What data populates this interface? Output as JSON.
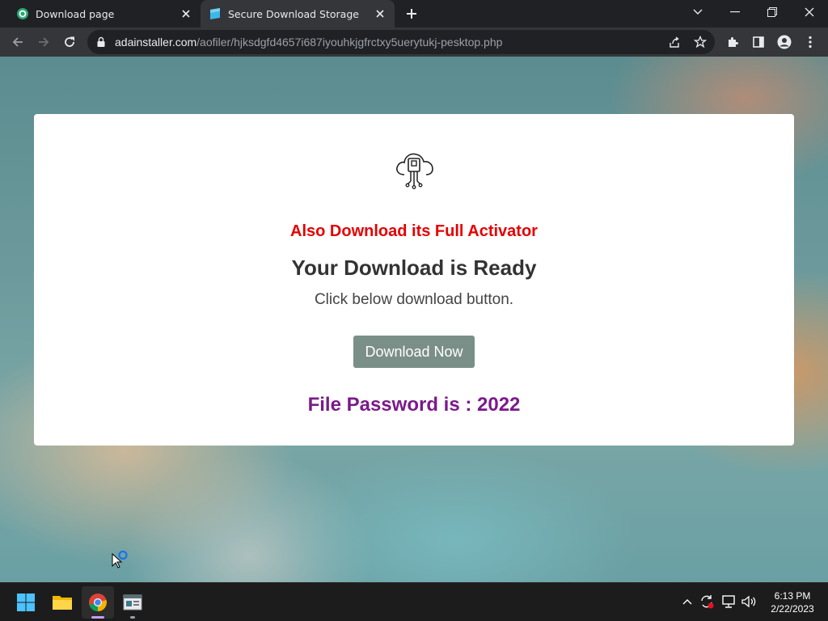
{
  "tabs": [
    {
      "title": "Download page",
      "favicon": "green-circle-favicon"
    },
    {
      "title": "Secure Download Storage",
      "favicon": "blue-storage-favicon"
    }
  ],
  "toolbar": {
    "url_domain": "adainstaller.com",
    "url_path": "/aofiler/hjksdgfd4657i687iyouhkjgfrctxy5uerytukj-pesktop.php"
  },
  "page": {
    "activator_text": "Also Download its Full Activator",
    "ready_title": "Your Download is Ready",
    "ready_subtitle": "Click below download button.",
    "download_button": "Download Now",
    "password_text": "File Password is : 2022",
    "icon": "cloud-circuit-icon"
  },
  "taskbar": {
    "apps": [
      "start-icon",
      "file-explorer-icon",
      "chrome-icon",
      "app-window-icon"
    ],
    "time": "6:13 PM",
    "date": "2/22/2023"
  },
  "colors": {
    "activator": "#e50000",
    "password": "#7b1a8a",
    "button": "#7a8f88",
    "accent_blue": "#1a73e8"
  }
}
